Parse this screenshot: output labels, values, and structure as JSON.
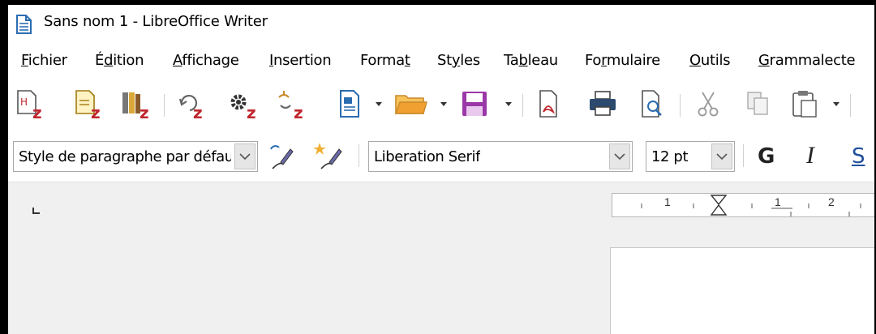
{
  "window": {
    "title": "Sans nom 1 - LibreOffice Writer"
  },
  "menu": {
    "items": [
      {
        "pre": "",
        "u": "F",
        "post": "ichier"
      },
      {
        "pre": "É",
        "u": "d",
        "post": "ition"
      },
      {
        "pre": "",
        "u": "A",
        "post": "ffichage"
      },
      {
        "pre": "",
        "u": "I",
        "post": "nsertion"
      },
      {
        "pre": "Forma",
        "u": "t",
        "post": ""
      },
      {
        "pre": "St",
        "u": "y",
        "post": "les"
      },
      {
        "pre": "Ta",
        "u": "b",
        "post": "leau"
      },
      {
        "pre": "Fo",
        "u": "r",
        "post": "mulaire"
      },
      {
        "pre": "",
        "u": "O",
        "post": "utils"
      },
      {
        "pre": "",
        "u": "G",
        "post": "rammalecte"
      }
    ]
  },
  "format_toolbar": {
    "paragraph_style": "Style de paragraphe par défaut",
    "font_name": "Liberation Serif",
    "font_size": "12 pt",
    "bold_label": "G",
    "italic_label": "I",
    "underline_label": "S"
  },
  "ruler": {
    "labels": [
      "1",
      "1",
      "2"
    ]
  },
  "icons": {
    "standard_toolbar": [
      "grammalecte-check-icon",
      "grammalecte-options-icon",
      "grammalecte-dictionary-icon",
      "grammalecte-refresh-icon",
      "grammalecte-settings-icon",
      "grammalecte-link-icon",
      "new-document-icon",
      "open-folder-icon",
      "save-icon",
      "export-pdf-icon",
      "print-icon",
      "print-preview-icon",
      "cut-icon",
      "copy-icon",
      "paste-icon"
    ]
  },
  "colors": {
    "grammalecte_red": "#c0262d",
    "folder_orange": "#f0a030",
    "save_purple": "#9b38a8",
    "doc_blue": "#2b6cb0"
  }
}
